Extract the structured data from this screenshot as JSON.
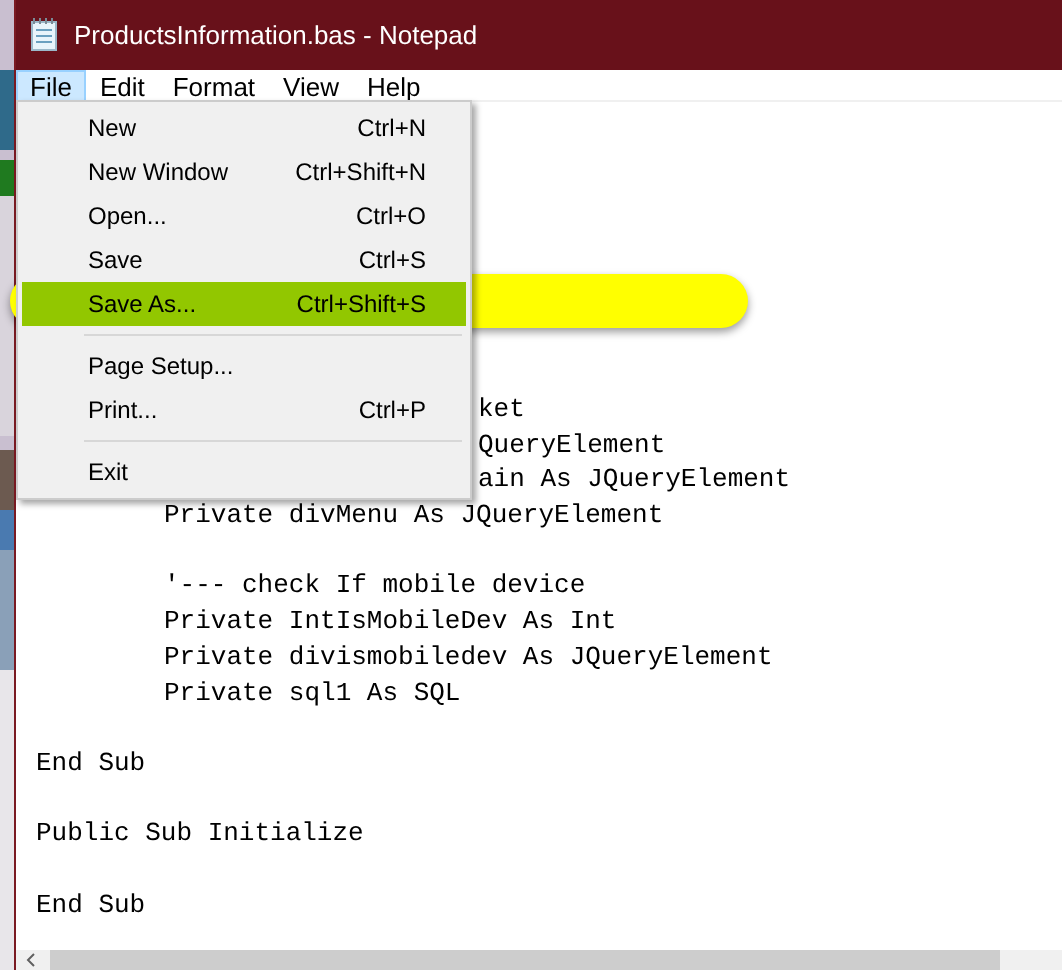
{
  "window": {
    "title": "ProductsInformation.bas - Notepad"
  },
  "menu_bar": [
    {
      "label": "File",
      "selected": true
    },
    {
      "label": "Edit",
      "selected": false
    },
    {
      "label": "Format",
      "selected": false
    },
    {
      "label": "View",
      "selected": false
    },
    {
      "label": "Help",
      "selected": false
    }
  ],
  "file_menu": [
    {
      "kind": "item",
      "label": "New",
      "shortcut": "Ctrl+N",
      "selected": false
    },
    {
      "kind": "item",
      "label": "New Window",
      "shortcut": "Ctrl+Shift+N",
      "selected": false
    },
    {
      "kind": "item",
      "label": "Open...",
      "shortcut": "Ctrl+O",
      "selected": false
    },
    {
      "kind": "item",
      "label": "Save",
      "shortcut": "Ctrl+S",
      "selected": false
    },
    {
      "kind": "item",
      "label": "Save As...",
      "shortcut": "Ctrl+Shift+S",
      "selected": true
    },
    {
      "kind": "separator"
    },
    {
      "kind": "item",
      "label": "Page Setup...",
      "selected": false
    },
    {
      "kind": "item",
      "label": "Print...",
      "shortcut": "Ctrl+P",
      "selected": false
    },
    {
      "kind": "separator"
    },
    {
      "kind": "item",
      "label": "Exit",
      "selected": false
    }
  ],
  "editor": {
    "lines": [
      {
        "kind": "partial",
        "text": "ket"
      },
      {
        "kind": "partial",
        "text": "QueryElement"
      },
      {
        "kind": "partial",
        "text": "ain As JQueryElement"
      },
      {
        "kind": "indented",
        "text": "Private divMenu As JQueryElement"
      },
      {
        "kind": "blank"
      },
      {
        "kind": "indented",
        "text": "'--- check If mobile device"
      },
      {
        "kind": "indented",
        "text": "Private IntIsMobileDev As Int"
      },
      {
        "kind": "indented",
        "text": "Private divismobiledev As JQueryElement"
      },
      {
        "kind": "indented",
        "text": "Private sql1 As SQL"
      },
      {
        "kind": "blank"
      },
      {
        "kind": "plain",
        "text": "End Sub"
      },
      {
        "kind": "blank"
      },
      {
        "kind": "plain",
        "text": "Public Sub Initialize"
      },
      {
        "kind": "blank"
      },
      {
        "kind": "plain",
        "text": "End Sub"
      }
    ]
  }
}
